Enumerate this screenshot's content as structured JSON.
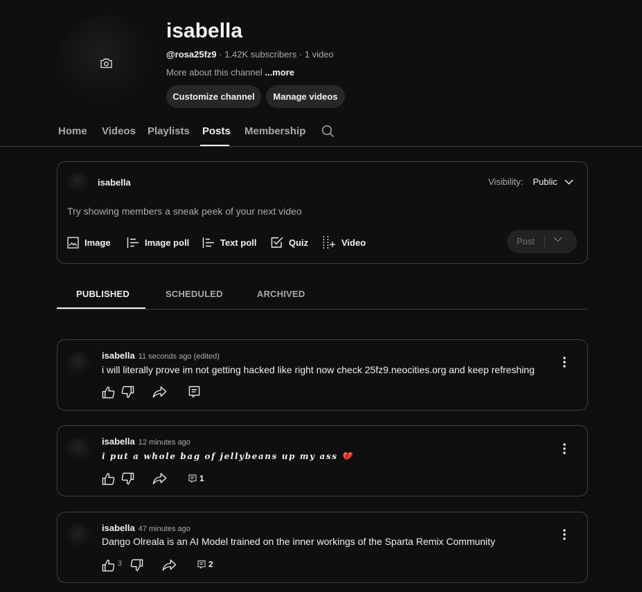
{
  "channel": {
    "name": "isabella",
    "handle": "@rosa25fz9",
    "stats": " · 1.42K subscribers · 1 video",
    "about": "More about this channel ",
    "more_label": "...more",
    "customize_label": "Customize channel",
    "manage_label": "Manage videos"
  },
  "tabs": [
    "Home",
    "Videos",
    "Playlists",
    "Posts",
    "Membership"
  ],
  "active_tab": "Posts",
  "composer": {
    "author": "isabella",
    "visibility_label": "Visibility:",
    "visibility_value": "Public",
    "placeholder": "Try showing members a sneak peek of your next video",
    "tools": [
      "Image",
      "Image poll",
      "Text poll",
      "Quiz",
      "Video"
    ],
    "post_label": "Post"
  },
  "post_tabs": [
    "PUBLISHED",
    "SCHEDULED",
    "ARCHIVED"
  ],
  "active_post_tab": "PUBLISHED",
  "posts": [
    {
      "author": "isabella",
      "time": "11 seconds ago (edited)",
      "text": "i will literally prove im not getting hacked like right now check 25fz9.neocities.org and keep refreshing",
      "likes": "",
      "comments": ""
    },
    {
      "author": "isabella",
      "time": "12 minutes ago",
      "text": "i put a whole bag of jellybeans up my ass 💔",
      "likes": "",
      "comments": "1"
    },
    {
      "author": "isabella",
      "time": "47 minutes ago",
      "text": "Dango Olreala is an AI Model trained on the inner workings of the Sparta Remix Community",
      "likes": "3",
      "comments": "2"
    }
  ],
  "colors": {
    "background": "#0f0f0f",
    "card_border": "#3f3f3f",
    "pill": "#272727",
    "text_primary": "#f1f1f1",
    "text_secondary": "#aaaaaa",
    "heart": "#e0314b"
  },
  "icons": [
    "camera-icon",
    "search-icon",
    "chevron-down-icon",
    "image-icon",
    "image-poll-icon",
    "text-poll-icon",
    "quiz-icon",
    "video-icon",
    "like-icon",
    "dislike-icon",
    "share-icon",
    "comment-icon",
    "more-vert-icon"
  ]
}
